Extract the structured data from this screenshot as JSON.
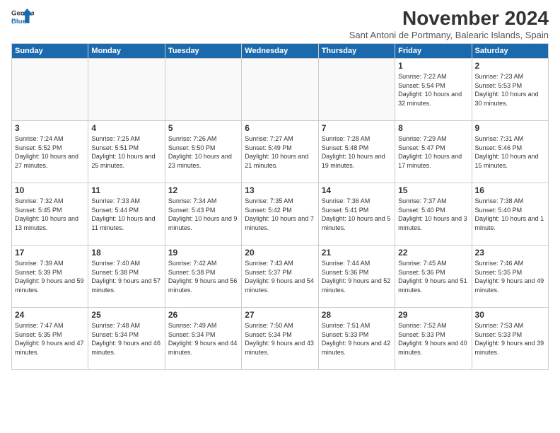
{
  "logo": {
    "line1": "General",
    "line2": "Blue"
  },
  "title": "November 2024",
  "subtitle": "Sant Antoni de Portmany, Balearic Islands, Spain",
  "weekdays": [
    "Sunday",
    "Monday",
    "Tuesday",
    "Wednesday",
    "Thursday",
    "Friday",
    "Saturday"
  ],
  "weeks": [
    [
      {
        "day": "",
        "info": ""
      },
      {
        "day": "",
        "info": ""
      },
      {
        "day": "",
        "info": ""
      },
      {
        "day": "",
        "info": ""
      },
      {
        "day": "",
        "info": ""
      },
      {
        "day": "1",
        "info": "Sunrise: 7:22 AM\nSunset: 5:54 PM\nDaylight: 10 hours and 32 minutes."
      },
      {
        "day": "2",
        "info": "Sunrise: 7:23 AM\nSunset: 5:53 PM\nDaylight: 10 hours and 30 minutes."
      }
    ],
    [
      {
        "day": "3",
        "info": "Sunrise: 7:24 AM\nSunset: 5:52 PM\nDaylight: 10 hours and 27 minutes."
      },
      {
        "day": "4",
        "info": "Sunrise: 7:25 AM\nSunset: 5:51 PM\nDaylight: 10 hours and 25 minutes."
      },
      {
        "day": "5",
        "info": "Sunrise: 7:26 AM\nSunset: 5:50 PM\nDaylight: 10 hours and 23 minutes."
      },
      {
        "day": "6",
        "info": "Sunrise: 7:27 AM\nSunset: 5:49 PM\nDaylight: 10 hours and 21 minutes."
      },
      {
        "day": "7",
        "info": "Sunrise: 7:28 AM\nSunset: 5:48 PM\nDaylight: 10 hours and 19 minutes."
      },
      {
        "day": "8",
        "info": "Sunrise: 7:29 AM\nSunset: 5:47 PM\nDaylight: 10 hours and 17 minutes."
      },
      {
        "day": "9",
        "info": "Sunrise: 7:31 AM\nSunset: 5:46 PM\nDaylight: 10 hours and 15 minutes."
      }
    ],
    [
      {
        "day": "10",
        "info": "Sunrise: 7:32 AM\nSunset: 5:45 PM\nDaylight: 10 hours and 13 minutes."
      },
      {
        "day": "11",
        "info": "Sunrise: 7:33 AM\nSunset: 5:44 PM\nDaylight: 10 hours and 11 minutes."
      },
      {
        "day": "12",
        "info": "Sunrise: 7:34 AM\nSunset: 5:43 PM\nDaylight: 10 hours and 9 minutes."
      },
      {
        "day": "13",
        "info": "Sunrise: 7:35 AM\nSunset: 5:42 PM\nDaylight: 10 hours and 7 minutes."
      },
      {
        "day": "14",
        "info": "Sunrise: 7:36 AM\nSunset: 5:41 PM\nDaylight: 10 hours and 5 minutes."
      },
      {
        "day": "15",
        "info": "Sunrise: 7:37 AM\nSunset: 5:40 PM\nDaylight: 10 hours and 3 minutes."
      },
      {
        "day": "16",
        "info": "Sunrise: 7:38 AM\nSunset: 5:40 PM\nDaylight: 10 hours and 1 minute."
      }
    ],
    [
      {
        "day": "17",
        "info": "Sunrise: 7:39 AM\nSunset: 5:39 PM\nDaylight: 9 hours and 59 minutes."
      },
      {
        "day": "18",
        "info": "Sunrise: 7:40 AM\nSunset: 5:38 PM\nDaylight: 9 hours and 57 minutes."
      },
      {
        "day": "19",
        "info": "Sunrise: 7:42 AM\nSunset: 5:38 PM\nDaylight: 9 hours and 56 minutes."
      },
      {
        "day": "20",
        "info": "Sunrise: 7:43 AM\nSunset: 5:37 PM\nDaylight: 9 hours and 54 minutes."
      },
      {
        "day": "21",
        "info": "Sunrise: 7:44 AM\nSunset: 5:36 PM\nDaylight: 9 hours and 52 minutes."
      },
      {
        "day": "22",
        "info": "Sunrise: 7:45 AM\nSunset: 5:36 PM\nDaylight: 9 hours and 51 minutes."
      },
      {
        "day": "23",
        "info": "Sunrise: 7:46 AM\nSunset: 5:35 PM\nDaylight: 9 hours and 49 minutes."
      }
    ],
    [
      {
        "day": "24",
        "info": "Sunrise: 7:47 AM\nSunset: 5:35 PM\nDaylight: 9 hours and 47 minutes."
      },
      {
        "day": "25",
        "info": "Sunrise: 7:48 AM\nSunset: 5:34 PM\nDaylight: 9 hours and 46 minutes."
      },
      {
        "day": "26",
        "info": "Sunrise: 7:49 AM\nSunset: 5:34 PM\nDaylight: 9 hours and 44 minutes."
      },
      {
        "day": "27",
        "info": "Sunrise: 7:50 AM\nSunset: 5:34 PM\nDaylight: 9 hours and 43 minutes."
      },
      {
        "day": "28",
        "info": "Sunrise: 7:51 AM\nSunset: 5:33 PM\nDaylight: 9 hours and 42 minutes."
      },
      {
        "day": "29",
        "info": "Sunrise: 7:52 AM\nSunset: 5:33 PM\nDaylight: 9 hours and 40 minutes."
      },
      {
        "day": "30",
        "info": "Sunrise: 7:53 AM\nSunset: 5:33 PM\nDaylight: 9 hours and 39 minutes."
      }
    ]
  ]
}
